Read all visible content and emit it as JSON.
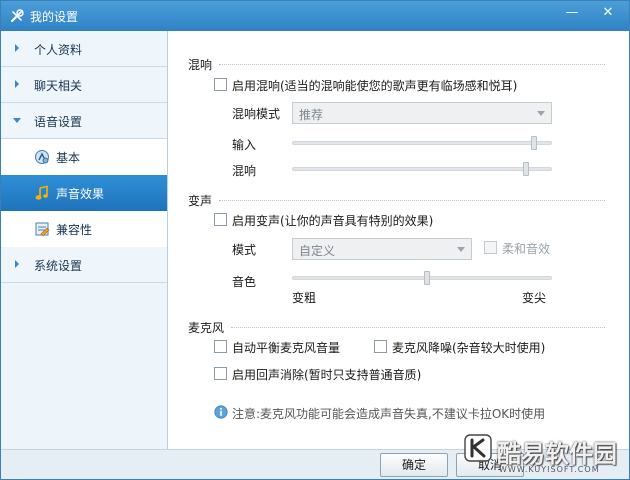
{
  "window": {
    "title": "我的设置",
    "minimize_glyph": "—",
    "close_glyph": "✕"
  },
  "sidebar": {
    "items": [
      {
        "label": "个人资料",
        "expanded": false
      },
      {
        "label": "聊天相关",
        "expanded": false
      },
      {
        "label": "语音设置",
        "expanded": true
      },
      {
        "label": "系统设置",
        "expanded": false
      }
    ],
    "subitems": [
      {
        "label": "基本",
        "icon": "voice-basic-icon",
        "active": false
      },
      {
        "label": "声音效果",
        "icon": "music-note-icon",
        "active": true
      },
      {
        "label": "兼容性",
        "icon": "compatibility-icon",
        "active": false
      }
    ]
  },
  "reverb": {
    "section_title": "混响",
    "enable_label": "启用混响(适当的混响能使您的歌声更有临场感和悦耳)",
    "enable_checked": false,
    "mode_label": "混响模式",
    "mode_value": "推荐",
    "input_label": "输入",
    "input_level": 0.93,
    "reverb_label": "混响",
    "reverb_level": 0.9
  },
  "voice_change": {
    "section_title": "变声",
    "enable_label": "启用变声(让你的声音具有特别的效果)",
    "enable_checked": false,
    "mode_label": "模式",
    "mode_value": "自定义",
    "soft_label": "柔和音效",
    "soft_checked": false,
    "tone_label": "音色",
    "tone_level": 0.52,
    "tone_min_label": "变粗",
    "tone_max_label": "变尖"
  },
  "microphone": {
    "section_title": "麦克风",
    "auto_balance_label": "自动平衡麦克风音量",
    "auto_balance_checked": false,
    "noise_reduction_label": "麦克风降噪(杂音较大时使用)",
    "noise_reduction_checked": false,
    "echo_cancel_label": "启用回声消除(暂时只支持普通音质)",
    "echo_cancel_checked": false,
    "notice": "注意:麦克风功能可能会造成声音失真,不建议卡拉OK时使用"
  },
  "buttons": {
    "ok_label": "确定",
    "cancel_label": "取消"
  },
  "watermark": {
    "text": "酷易软件园",
    "url": "WWW.KUYISOFT.COM"
  },
  "colors": {
    "titlebar": "#2f83c5",
    "active_item": "#1f73bb"
  }
}
